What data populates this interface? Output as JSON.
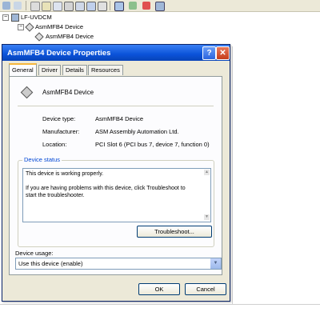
{
  "window": {
    "title": "AsmMFB4 Device Properties",
    "help_glyph": "?",
    "close_glyph": "✕"
  },
  "tree": {
    "root": "LF-UVDCM",
    "child": "AsmMFB4 Device",
    "grandchild": "AsmMFB4 Device",
    "expand_glyph": "−"
  },
  "tabs": [
    {
      "label": "General"
    },
    {
      "label": "Driver"
    },
    {
      "label": "Details"
    },
    {
      "label": "Resources"
    }
  ],
  "general": {
    "device_name": "AsmMFB4 Device",
    "labels": {
      "type": "Device type:",
      "manufacturer": "Manufacturer:",
      "location": "Location:"
    },
    "values": {
      "type": "AsmMFB4 Device",
      "manufacturer": "ASM Assembly Automation Ltd.",
      "location": "PCI Slot 6 (PCI bus 7, device 7, function 0)"
    },
    "status_group_title": "Device status",
    "status_lines": [
      "This device is working properly.",
      "If you are having problems with this device, click Troubleshoot to",
      "start the troubleshooter."
    ],
    "troubleshoot_label": "Troubleshoot...",
    "usage_label": "Device usage:",
    "usage_value": "Use this device (enable)"
  },
  "buttons": {
    "ok": "OK",
    "cancel": "Cancel"
  },
  "colors": {
    "titlebar": "#0a52d9",
    "dialog_bg": "#ece9d8",
    "group_title": "#0046d5",
    "active_tab_accent": "#f6b73c"
  }
}
